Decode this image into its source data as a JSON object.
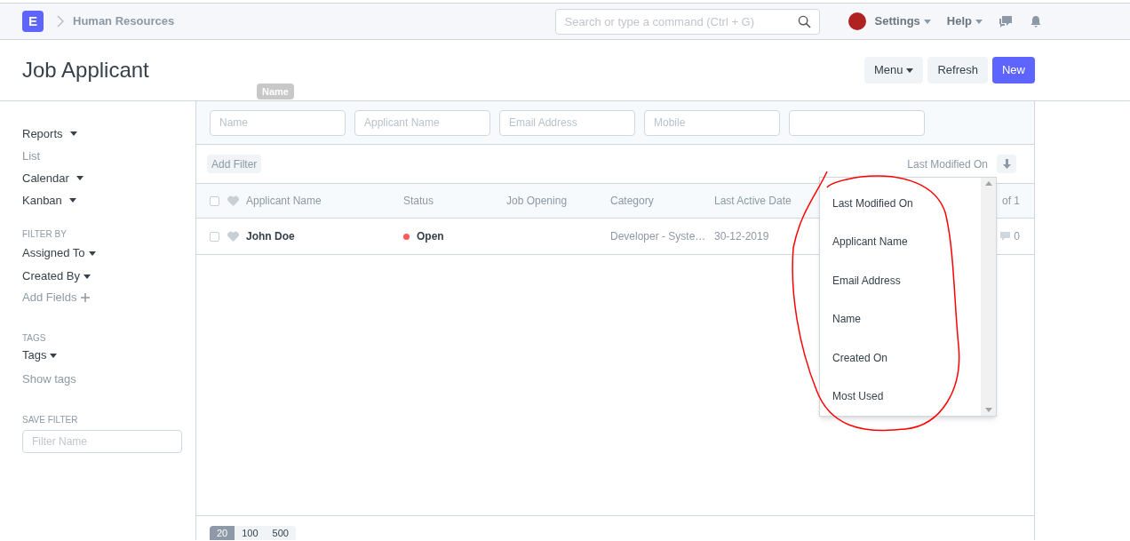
{
  "app": {
    "logo": "E",
    "breadcrumb": "Human Resources"
  },
  "search": {
    "placeholder": "Search or type a command (Ctrl + G)"
  },
  "nav_menus": [
    {
      "label": "Settings"
    },
    {
      "label": "Help"
    }
  ],
  "page": {
    "title": "Job Applicant",
    "buttons": [
      {
        "label": "Menu",
        "kind": "dropdown"
      },
      {
        "label": "Refresh",
        "kind": "default"
      },
      {
        "label": "New",
        "kind": "primary"
      }
    ]
  },
  "sidebar": {
    "views": [
      {
        "label": "Reports",
        "dropdown": true
      },
      {
        "label": "List",
        "dropdown": false
      },
      {
        "label": "Calendar",
        "dropdown": true
      },
      {
        "label": "Kanban",
        "dropdown": true
      }
    ],
    "filter_by": {
      "heading": "FILTER BY",
      "items": [
        "Assigned To",
        "Created By"
      ],
      "add_label": "Add Fields"
    },
    "tags": {
      "heading": "TAGS",
      "items": [
        "Tags"
      ],
      "show_label": "Show tags"
    },
    "save_filter": {
      "heading": "SAVE FILTER",
      "placeholder": "Filter Name"
    }
  },
  "filters": {
    "tooltip": "Name",
    "fields": [
      {
        "kind": "text",
        "placeholder": "Name"
      },
      {
        "kind": "text",
        "placeholder": "Applicant Name"
      },
      {
        "kind": "text",
        "placeholder": "Email Address"
      },
      {
        "kind": "text",
        "placeholder": "Mobile"
      },
      {
        "kind": "text"
      }
    ]
  },
  "toolbar": {
    "add_filter": "Add Filter",
    "sort_label": "Last Modified On"
  },
  "table": {
    "all_checked": false,
    "columns": [
      "Applicant Name",
      "Status",
      "Job Opening",
      "Category",
      "Last Active Date"
    ],
    "page_count": "of 1",
    "rows": [
      {
        "name": "John Doe",
        "checked": false,
        "status": "Open",
        "color": "#ff5858",
        "category": "Developer - Syste…",
        "last_active": "30-12-2019",
        "comments": "0"
      }
    ]
  },
  "sort_menu": {
    "items": [
      "Last Modified On",
      "Applicant Name",
      "Email Address",
      "Name",
      "Created On",
      "Most Used"
    ]
  },
  "paging": [
    {
      "label": "20",
      "selected": true
    },
    {
      "label": "100",
      "selected": false
    },
    {
      "label": "500",
      "selected": false
    }
  ]
}
